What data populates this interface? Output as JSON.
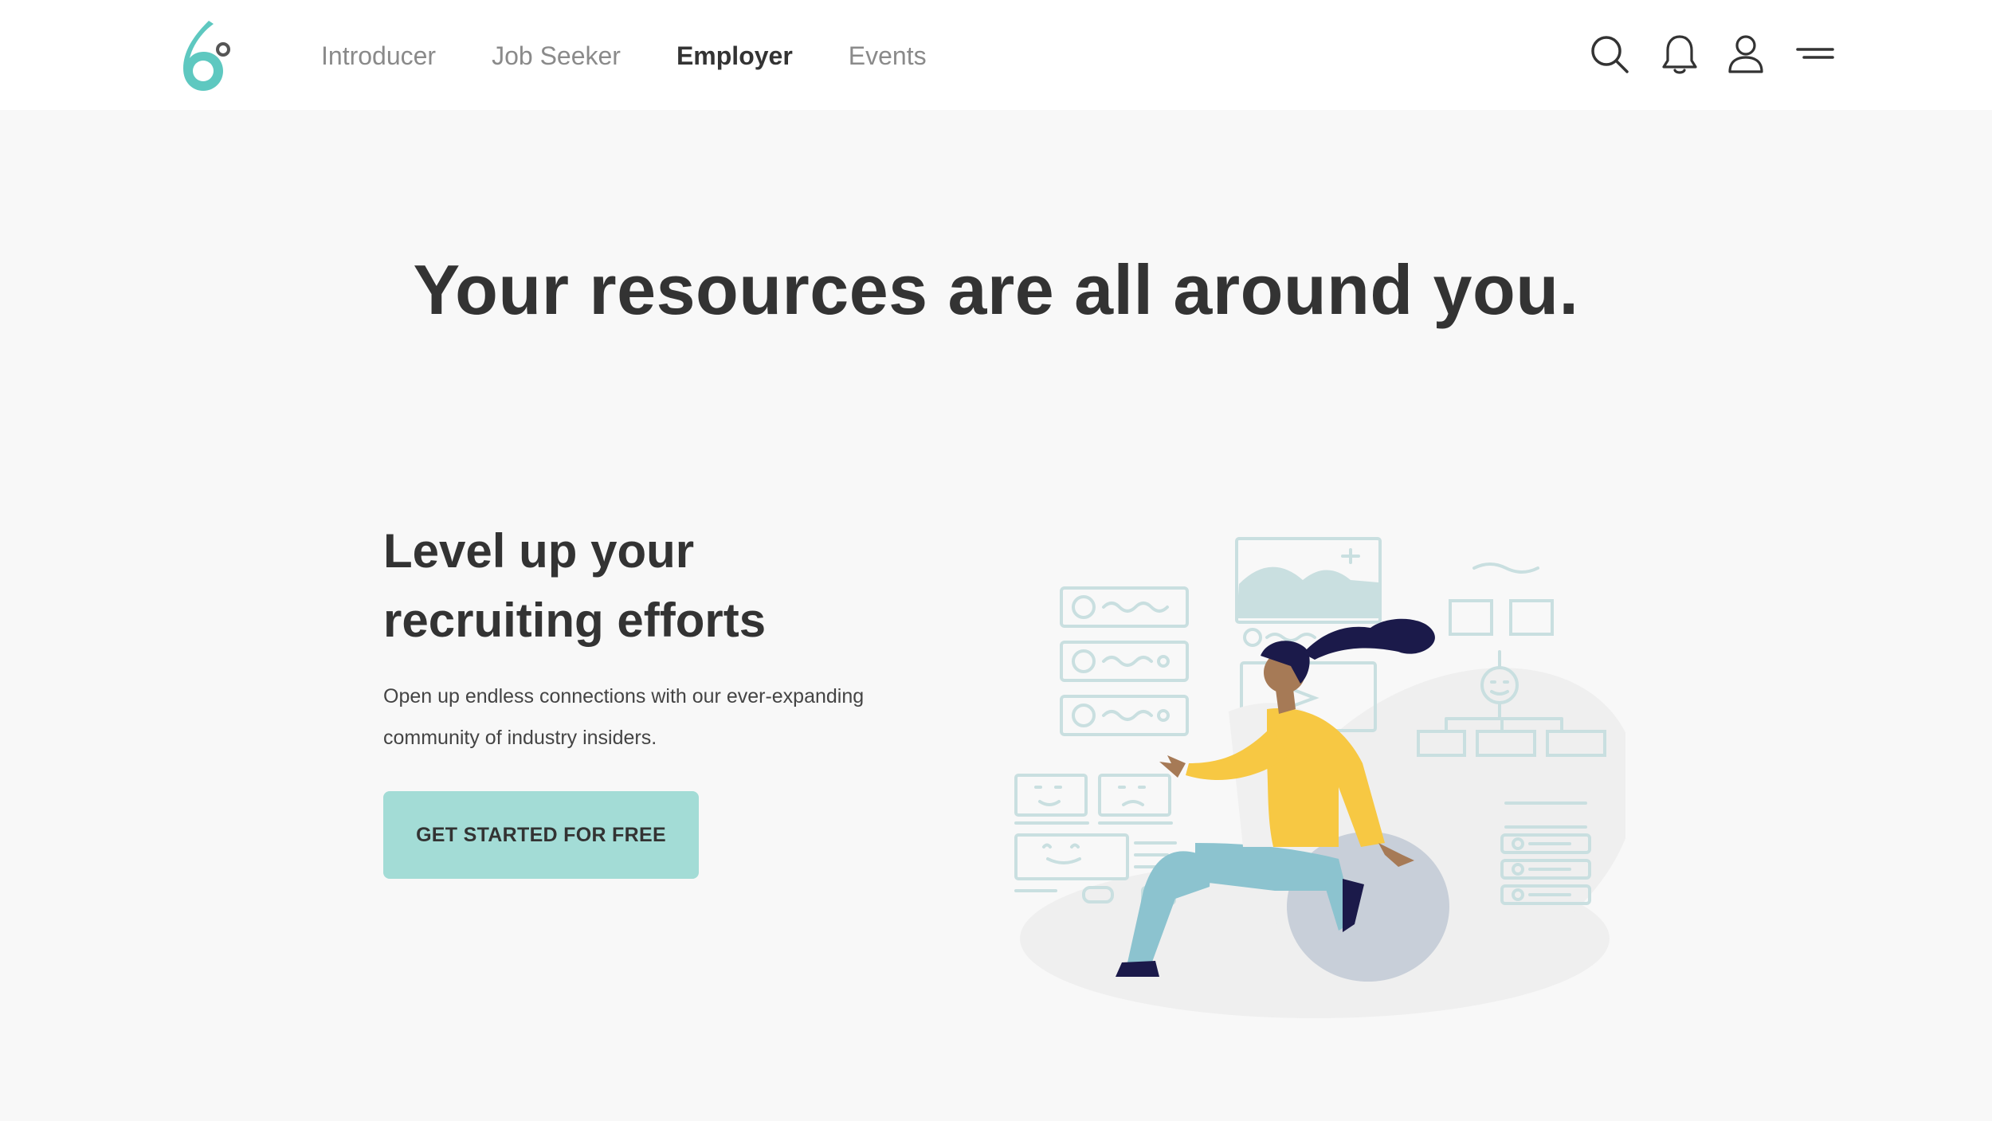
{
  "brand": {
    "logo_name": "6-degrees-logo",
    "accent_color": "#5ec8c0"
  },
  "nav": {
    "items": [
      {
        "label": "Introducer",
        "active": false
      },
      {
        "label": "Job Seeker",
        "active": false
      },
      {
        "label": "Employer",
        "active": true
      },
      {
        "label": "Events",
        "active": false
      }
    ]
  },
  "header_icons": [
    "search-icon",
    "bell-icon",
    "user-icon",
    "menu-icon"
  ],
  "hero": {
    "headline": "Your resources are all around you.",
    "subhead_line1": "Level up your",
    "subhead_line2": "recruiting efforts",
    "body_line1": "Open up endless connections with our ever-expanding",
    "body_line2": "community of industry insiders.",
    "cta_label": "GET STARTED FOR FREE",
    "cta_color": "#a3dcd6"
  },
  "illustration": {
    "name": "woman-on-exercise-ball-illustration",
    "colors": {
      "hair": "#1b1a4a",
      "jacket": "#f7c843",
      "pants": "#8cc3cf",
      "ball": "#c8cfd9",
      "skin": "#a67a56",
      "sketch": "#c9dfe0"
    }
  }
}
